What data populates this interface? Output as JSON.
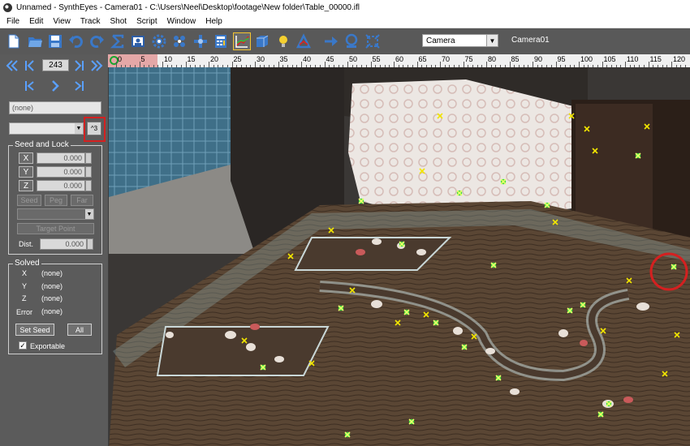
{
  "window": {
    "title": "Unnamed - SynthEyes - Camera01 - C:\\Users\\Neel\\Desktop\\footage\\New folder\\Table_00000.ifl"
  },
  "menu": [
    "File",
    "Edit",
    "View",
    "Track",
    "Shot",
    "Script",
    "Window",
    "Help"
  ],
  "toolbar": {
    "icons": [
      "new-file-icon",
      "open-folder-icon",
      "save-icon",
      "undo-icon",
      "redo-icon",
      "sigma-icon",
      "image-preview-icon",
      "gear-icon",
      "cluster-icon",
      "move-icon",
      "calculator-icon",
      "graph-icon",
      "box-icon",
      "lightbulb-icon",
      "triangle-icon",
      "arrow-right-icon",
      "zoom-fit-icon",
      "select-icon"
    ],
    "camera_select": "Camera",
    "camera_name": "Camera01"
  },
  "playback": {
    "frame": "243"
  },
  "tracker": {
    "name_placeholder": "(none)",
    "small_button_label": "^3"
  },
  "seed_lock": {
    "legend": "Seed and Lock",
    "x_label": "X",
    "y_label": "Y",
    "z_label": "Z",
    "x_value": "0.000",
    "y_value": "0.000",
    "z_value": "0.000",
    "seed_label": "Seed",
    "peg_label": "Peg",
    "far_label": "Far",
    "target_point_label": "Target Point",
    "dist_label": "Dist.",
    "dist_value": "0.000"
  },
  "solved": {
    "legend": "Solved",
    "x_label": "X",
    "x_value": "(none)",
    "y_label": "Y",
    "y_value": "(none)",
    "z_label": "Z",
    "z_value": "(none)",
    "error_label": "Error",
    "error_value": "(none)",
    "set_seed_label": "Set Seed",
    "all_label": "All",
    "exportable_label": "Exportable",
    "exportable_checked": true
  },
  "ruler": {
    "labels": [
      "0",
      "5",
      "10",
      "15",
      "20",
      "25",
      "30",
      "35",
      "40",
      "45",
      "50",
      "55",
      "60",
      "65",
      "70",
      "75",
      "80",
      "85",
      "90",
      "95",
      "100",
      "105",
      "110",
      "115",
      "120",
      "12"
    ]
  },
  "colors": {
    "highlight": "#d42020",
    "tracker_yellow": "#f2e600",
    "tracker_green": "#3ddc3d",
    "ruler_range": "#e4a7a7"
  }
}
